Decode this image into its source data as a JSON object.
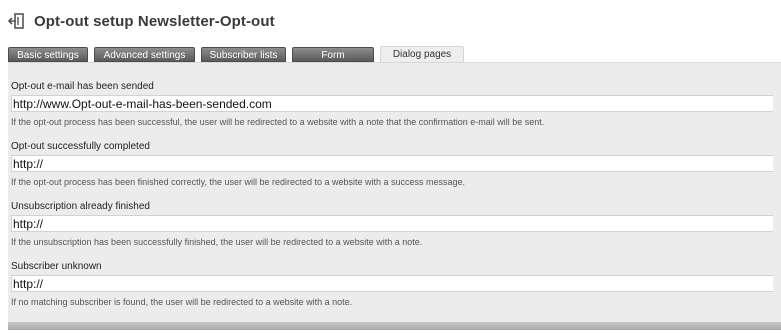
{
  "header": {
    "title": "Opt-out setup Newsletter-Opt-out",
    "icon": "exit-door-icon"
  },
  "tabs": [
    {
      "label": "Basic settings",
      "active": false
    },
    {
      "label": "Advanced settings",
      "active": false
    },
    {
      "label": "Subscriber lists",
      "active": false
    },
    {
      "label": "Form",
      "active": false
    },
    {
      "label": "Dialog pages",
      "active": true
    }
  ],
  "fields": [
    {
      "label": "Opt-out e-mail has been sended",
      "value": "http://www.Opt-out-e-mail-has-been-sended.com",
      "hint": "If the opt-out process has been successful, the user will be redirected to a website with a note that the confirmation e-mail will be sent."
    },
    {
      "label": "Opt-out successfully completed",
      "value": "http://",
      "hint": "If the opt-out process has been finished correctly, the user will be redirected to a website with a success message."
    },
    {
      "label": "Unsubscription already finished",
      "value": "http://",
      "hint": "If the unsubscription has been successfully finished, the user will be redirected to a website with a note."
    },
    {
      "label": "Subscriber unknown",
      "value": "http://",
      "hint": "If no matching subscriber is found, the user will be redirected to a website with a note."
    }
  ],
  "colors": {
    "tab_inactive": "#6e6e6e",
    "tab_active": "#eeeeee",
    "panel_background": "#ececec",
    "title_text": "#3a3a3a"
  }
}
